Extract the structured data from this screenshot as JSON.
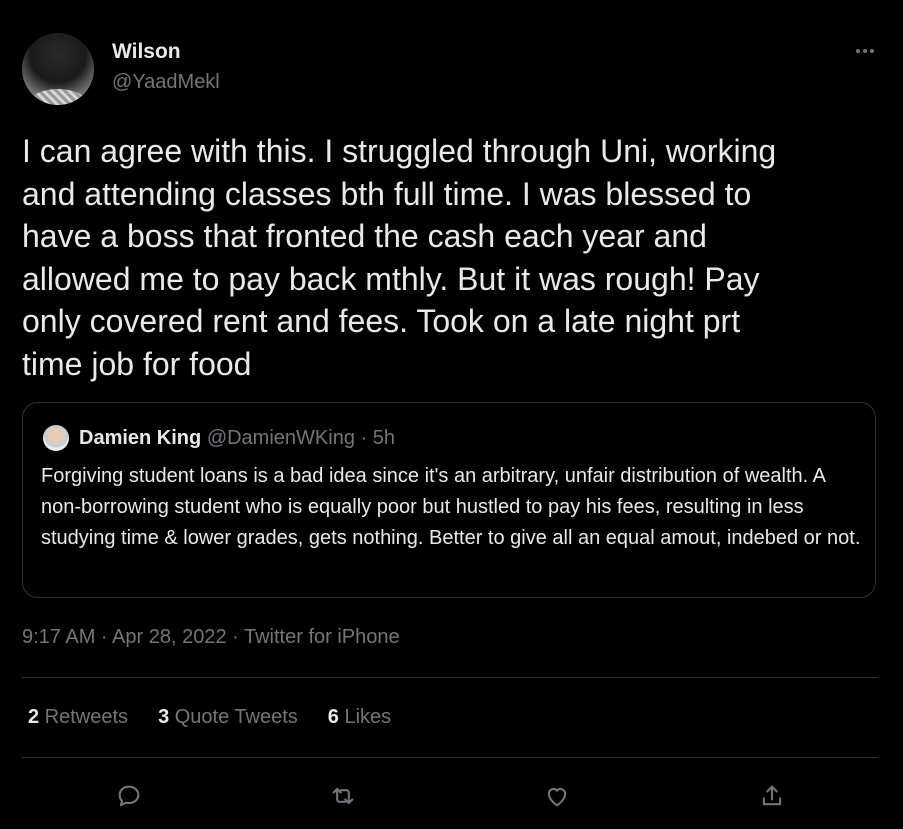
{
  "author": {
    "name": "Wilson",
    "handle": "@YaadMekl",
    "avatar_icon": "profile-avatar"
  },
  "tweet": {
    "text": "I can agree with this. I struggled through Uni, working\nand attending classes bth full time. I was blessed to\nhave a boss that fronted the cash each year and\nallowed me to pay back mthly. But it was rough! Pay\nonly covered rent and fees. Took on a late night prt\ntime job for food",
    "timestamp": "9:17 AM · Apr 28, 2022 · Twitter for iPhone"
  },
  "quote": {
    "name": "Damien King",
    "handle": "@DamienWKing",
    "age": " · 5h",
    "text": "Forgiving student loans is a bad idea since it's an arbitrary, unfair distribution of wealth. A non-borrowing student who is equally poor but hustled to pay his fees, resulting in less studying time & lower grades, gets nothing. Better to give all an equal amout, indebed or not."
  },
  "stats": {
    "retweets_count": "2",
    "retweets_label": " Retweets",
    "quotes_count": "3",
    "quotes_label": " Quote Tweets",
    "likes_count": "6",
    "likes_label": " Likes"
  },
  "actions": [
    "reply-icon",
    "retweet-icon",
    "like-icon",
    "share-icon"
  ],
  "colors": {
    "background": "#000000",
    "text": "#e7e9ea",
    "secondary": "#71767b",
    "border": "#2f3336"
  }
}
